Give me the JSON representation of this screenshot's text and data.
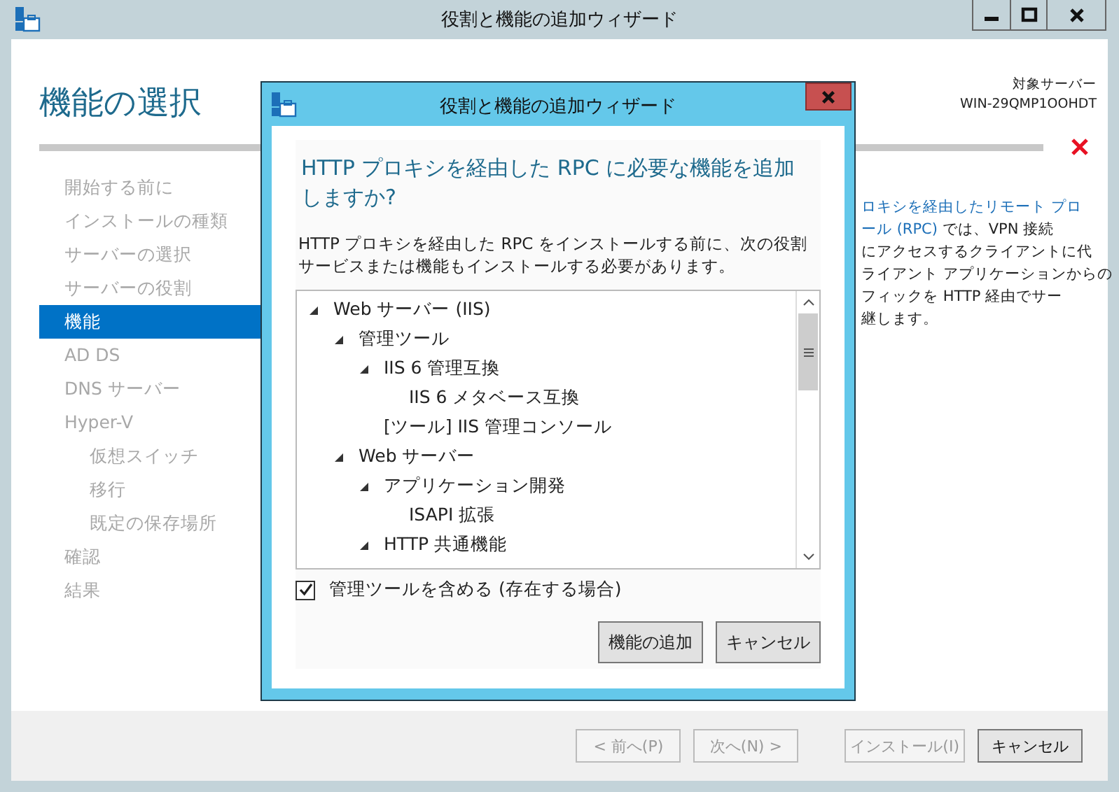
{
  "window": {
    "title": "役割と機能の追加ウィザード"
  },
  "header": {
    "title": "機能の選択",
    "target_label": "対象サーバー",
    "target_name": "WIN-29QMP1OOHDT"
  },
  "steps": [
    {
      "label": "開始する前に",
      "selected": false
    },
    {
      "label": "インストールの種類",
      "selected": false
    },
    {
      "label": "サーバーの選択",
      "selected": false
    },
    {
      "label": "サーバーの役割",
      "selected": false
    },
    {
      "label": "機能",
      "selected": true
    },
    {
      "label": "AD DS",
      "selected": false
    },
    {
      "label": "DNS サーバー",
      "selected": false
    },
    {
      "label": "Hyper-V",
      "selected": false,
      "children": [
        {
          "label": "仮想スイッチ",
          "selected": false
        },
        {
          "label": "移行",
          "selected": false
        },
        {
          "label": "既定の保存場所",
          "selected": false
        }
      ]
    },
    {
      "label": "確認",
      "selected": false
    },
    {
      "label": "結果",
      "selected": false
    }
  ],
  "description": [
    {
      "link": "ロキシを経由したリモート プロ"
    },
    {
      "link": "ール (RPC)",
      "text": " では、VPN 接続"
    },
    {
      "text": "にアクセスするクライアントに代"
    },
    {
      "text": "ライアント アプリケーションからの"
    },
    {
      "text": "フィックを HTTP 経由でサー"
    },
    {
      "text": "継します。"
    }
  ],
  "footer_buttons": [
    {
      "label": "< 前へ(P)",
      "disabled": true
    },
    {
      "label": "次へ(N) >",
      "disabled": true
    },
    {
      "label": "インストール(I)",
      "disabled": true
    },
    {
      "label": "キャンセル",
      "disabled": false
    }
  ],
  "dialog": {
    "title": "役割と機能の追加ウィザード",
    "heading": "HTTP プロキシを経由した RPC に必要な機能を追加しますか?",
    "message": "HTTP プロキシを経由した RPC をインストールする前に、次の役割サービスまたは機能もインストールする必要があります。",
    "tree": [
      {
        "label": "Web サーバー (IIS)",
        "expanded": true,
        "children": [
          {
            "label": "管理ツール",
            "expanded": true,
            "children": [
              {
                "label": "IIS 6 管理互換",
                "expanded": true,
                "children": [
                  {
                    "label": "IIS 6 メタベース互換"
                  }
                ]
              },
              {
                "label": "[ツール] IIS 管理コンソール"
              }
            ]
          },
          {
            "label": "Web サーバー",
            "expanded": true,
            "children": [
              {
                "label": "アプリケーション開発",
                "expanded": true,
                "children": [
                  {
                    "label": "ISAPI 拡張"
                  }
                ]
              },
              {
                "label": "HTTP 共通機能",
                "expanded": true
              }
            ]
          }
        ]
      }
    ],
    "include_tools": {
      "label": "管理ツールを含める (存在する場合)",
      "checked": true
    },
    "buttons": [
      "機能の追加",
      "キャンセル"
    ]
  }
}
